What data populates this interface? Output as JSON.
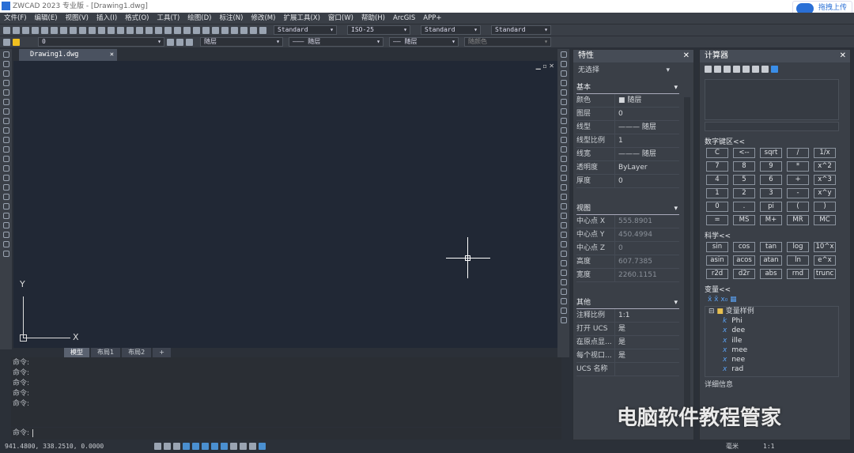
{
  "title": "ZWCAD 2023 专业版 - [Drawing1.dwg]",
  "upload_button": "拖拽上传",
  "menu": [
    "文件(F)",
    "编辑(E)",
    "视图(V)",
    "插入(I)",
    "格式(O)",
    "工具(T)",
    "绘图(D)",
    "标注(N)",
    "修改(M)",
    "扩展工具(X)",
    "窗口(W)",
    "帮助(H)",
    "ArcGIS",
    "APP+"
  ],
  "toolbar1": {
    "text_style": "Standard",
    "dim_style": "ISO-25",
    "table_style": "Standard",
    "multileader_style": "Standard"
  },
  "toolbar2": {
    "layer": "0",
    "color": "随层",
    "linetype": "——— 随层",
    "lineweight": "—— 随层",
    "plotstyle": "随颜色"
  },
  "doc_tab": "Drawing1.dwg",
  "layout_tabs": [
    "模型",
    "布局1",
    "布局2",
    "+"
  ],
  "ucs": {
    "x": "X",
    "y": "Y"
  },
  "command": {
    "history": [
      "命令:",
      "命令:",
      "命令:",
      "命令:",
      "命令:"
    ],
    "prompt": "命令:"
  },
  "status": {
    "coords": "941.4800, 338.2510, 0.0000",
    "units": "毫米",
    "scale": "1:1"
  },
  "properties": {
    "title": "特性",
    "selection": "无选择",
    "sections": [
      {
        "name": "基本",
        "rows": [
          [
            "颜色",
            "■ 随层"
          ],
          [
            "图层",
            "0"
          ],
          [
            "线型",
            "——— 随层"
          ],
          [
            "线型比例",
            "1"
          ],
          [
            "线宽",
            "——— 随层"
          ],
          [
            "透明度",
            "ByLayer"
          ],
          [
            "厚度",
            "0"
          ]
        ]
      },
      {
        "name": "视图",
        "rows": [
          [
            "中心点 X",
            "555.8901"
          ],
          [
            "中心点 Y",
            "450.4994"
          ],
          [
            "中心点 Z",
            "0"
          ],
          [
            "高度",
            "607.7385"
          ],
          [
            "宽度",
            "2260.1151"
          ]
        ],
        "dim": true
      },
      {
        "name": "其他",
        "rows": [
          [
            "注释比例",
            "1:1"
          ],
          [
            "打开 UCS ...",
            "是"
          ],
          [
            "在原点显...",
            "是"
          ],
          [
            "每个视口...",
            "是"
          ],
          [
            "UCS 名称",
            ""
          ]
        ]
      }
    ]
  },
  "calculator": {
    "title": "计算器",
    "numpad_label": "数字键区<<",
    "numpad": [
      "C",
      "<--",
      "sqrt",
      "/",
      "1/x",
      "7",
      "8",
      "9",
      "*",
      "x^2",
      "4",
      "5",
      "6",
      "+",
      "x^3",
      "1",
      "2",
      "3",
      "-",
      "x^y",
      "0",
      ".",
      "pi",
      "(",
      ")",
      "=",
      "MS",
      "M+",
      "MR",
      "MC"
    ],
    "sci_label": "科学<<",
    "sci": [
      "sin",
      "cos",
      "tan",
      "log",
      "10^x",
      "asin",
      "acos",
      "atan",
      "ln",
      "e^x",
      "r2d",
      "d2r",
      "abs",
      "rnd",
      "trunc"
    ],
    "vars_label": "变量<<",
    "var_folder": "变量样例",
    "vars": [
      [
        "k",
        "Phi"
      ],
      [
        "x",
        "dee"
      ],
      [
        "x",
        "ille"
      ],
      [
        "x",
        "mee"
      ],
      [
        "x",
        "nee"
      ],
      [
        "x",
        "rad"
      ]
    ],
    "details_label": "详细信息"
  },
  "watermark": "电脑软件教程管家"
}
